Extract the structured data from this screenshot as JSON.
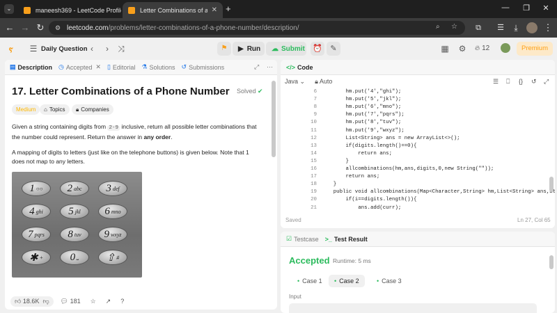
{
  "browser": {
    "tabs": [
      {
        "title": "maneesh369 - LeetCode Profile"
      },
      {
        "title": "Letter Combinations of a Phone"
      }
    ],
    "url_host": "leetcode.com",
    "url_path": "/problems/letter-combinations-of-a-phone-number/description/"
  },
  "topbar": {
    "daily_question": "Daily Question",
    "run": "Run",
    "submit": "Submit",
    "streak": "12",
    "premium": "Premium"
  },
  "left_tabs": [
    "Description",
    "Accepted",
    "Editorial",
    "Solutions",
    "Submissions"
  ],
  "problem": {
    "title": "17. Letter Combinations of a Phone Number",
    "status": "Solved",
    "difficulty": "Medium",
    "topics": "Topics",
    "companies": "Companies",
    "para1_a": "Given a string containing digits from ",
    "para1_code": "2-9",
    "para1_b": " inclusive, return all possible letter combinations that the number could represent. Return the answer in ",
    "para1_bold": "any order",
    "para1_c": ".",
    "para2": "A mapping of digits to letters (just like on the telephone buttons) is given below. Note that 1 does not map to any letters.",
    "likes": "18.6K",
    "comments": "181"
  },
  "keypad": [
    {
      "n": "1",
      "l": "○○"
    },
    {
      "n": "2",
      "l": "abc"
    },
    {
      "n": "3",
      "l": "def"
    },
    {
      "n": "4",
      "l": "ghi"
    },
    {
      "n": "5",
      "l": "jkl"
    },
    {
      "n": "6",
      "l": "mno"
    },
    {
      "n": "7",
      "l": "pqrs"
    },
    {
      "n": "8",
      "l": "tuv"
    },
    {
      "n": "9",
      "l": "wxyz"
    },
    {
      "n": "✱",
      "l": "+"
    },
    {
      "n": "0",
      "l": "⎵"
    },
    {
      "n": "⇧",
      "l": "#"
    }
  ],
  "code_panel": {
    "title": "Code",
    "language": "Java",
    "autosave": "Auto",
    "saved": "Saved",
    "cursor": "Ln 27, Col 65",
    "lines": [
      {
        "n": "6",
        "t": "        hm.put('4',\"ghi\");"
      },
      {
        "n": "7",
        "t": "        hm.put('5',\"jkl\");"
      },
      {
        "n": "8",
        "t": "        hm.put('6',\"mno\");"
      },
      {
        "n": "9",
        "t": "        hm.put('7',\"pqrs\");"
      },
      {
        "n": "10",
        "t": "        hm.put('8',\"tuv\");"
      },
      {
        "n": "11",
        "t": "        hm.put('9',\"wxyz\");"
      },
      {
        "n": "12",
        "t": "        List<String> ans = new ArrayList<>();"
      },
      {
        "n": "13",
        "t": "        if(digits.length()==0){"
      },
      {
        "n": "14",
        "t": "            return ans;"
      },
      {
        "n": "15",
        "t": "        }"
      },
      {
        "n": "16",
        "t": "        allcombinations(hm,ans,digits,0,new String(\"\"));"
      },
      {
        "n": "17",
        "t": "        return ans;"
      },
      {
        "n": "18",
        "t": "    }"
      },
      {
        "n": "19",
        "t": "    public void allcombinations(Map<Character,String> hm,List<String> ans,String"
      },
      {
        "n": "20",
        "t": "        if(i==digits.length()){"
      },
      {
        "n": "21",
        "t": "            ans.add(curr);"
      }
    ]
  },
  "test_panel": {
    "tab_testcase": "Testcase",
    "tab_result": "Test Result",
    "verdict": "Accepted",
    "runtime": "Runtime: 5 ms",
    "cases": [
      "Case 1",
      "Case 2",
      "Case 3"
    ],
    "input_label": "Input"
  },
  "colors": {
    "accent_green": "#2cbb5d",
    "medium": "#ffb800",
    "premium": "#ffa116"
  }
}
